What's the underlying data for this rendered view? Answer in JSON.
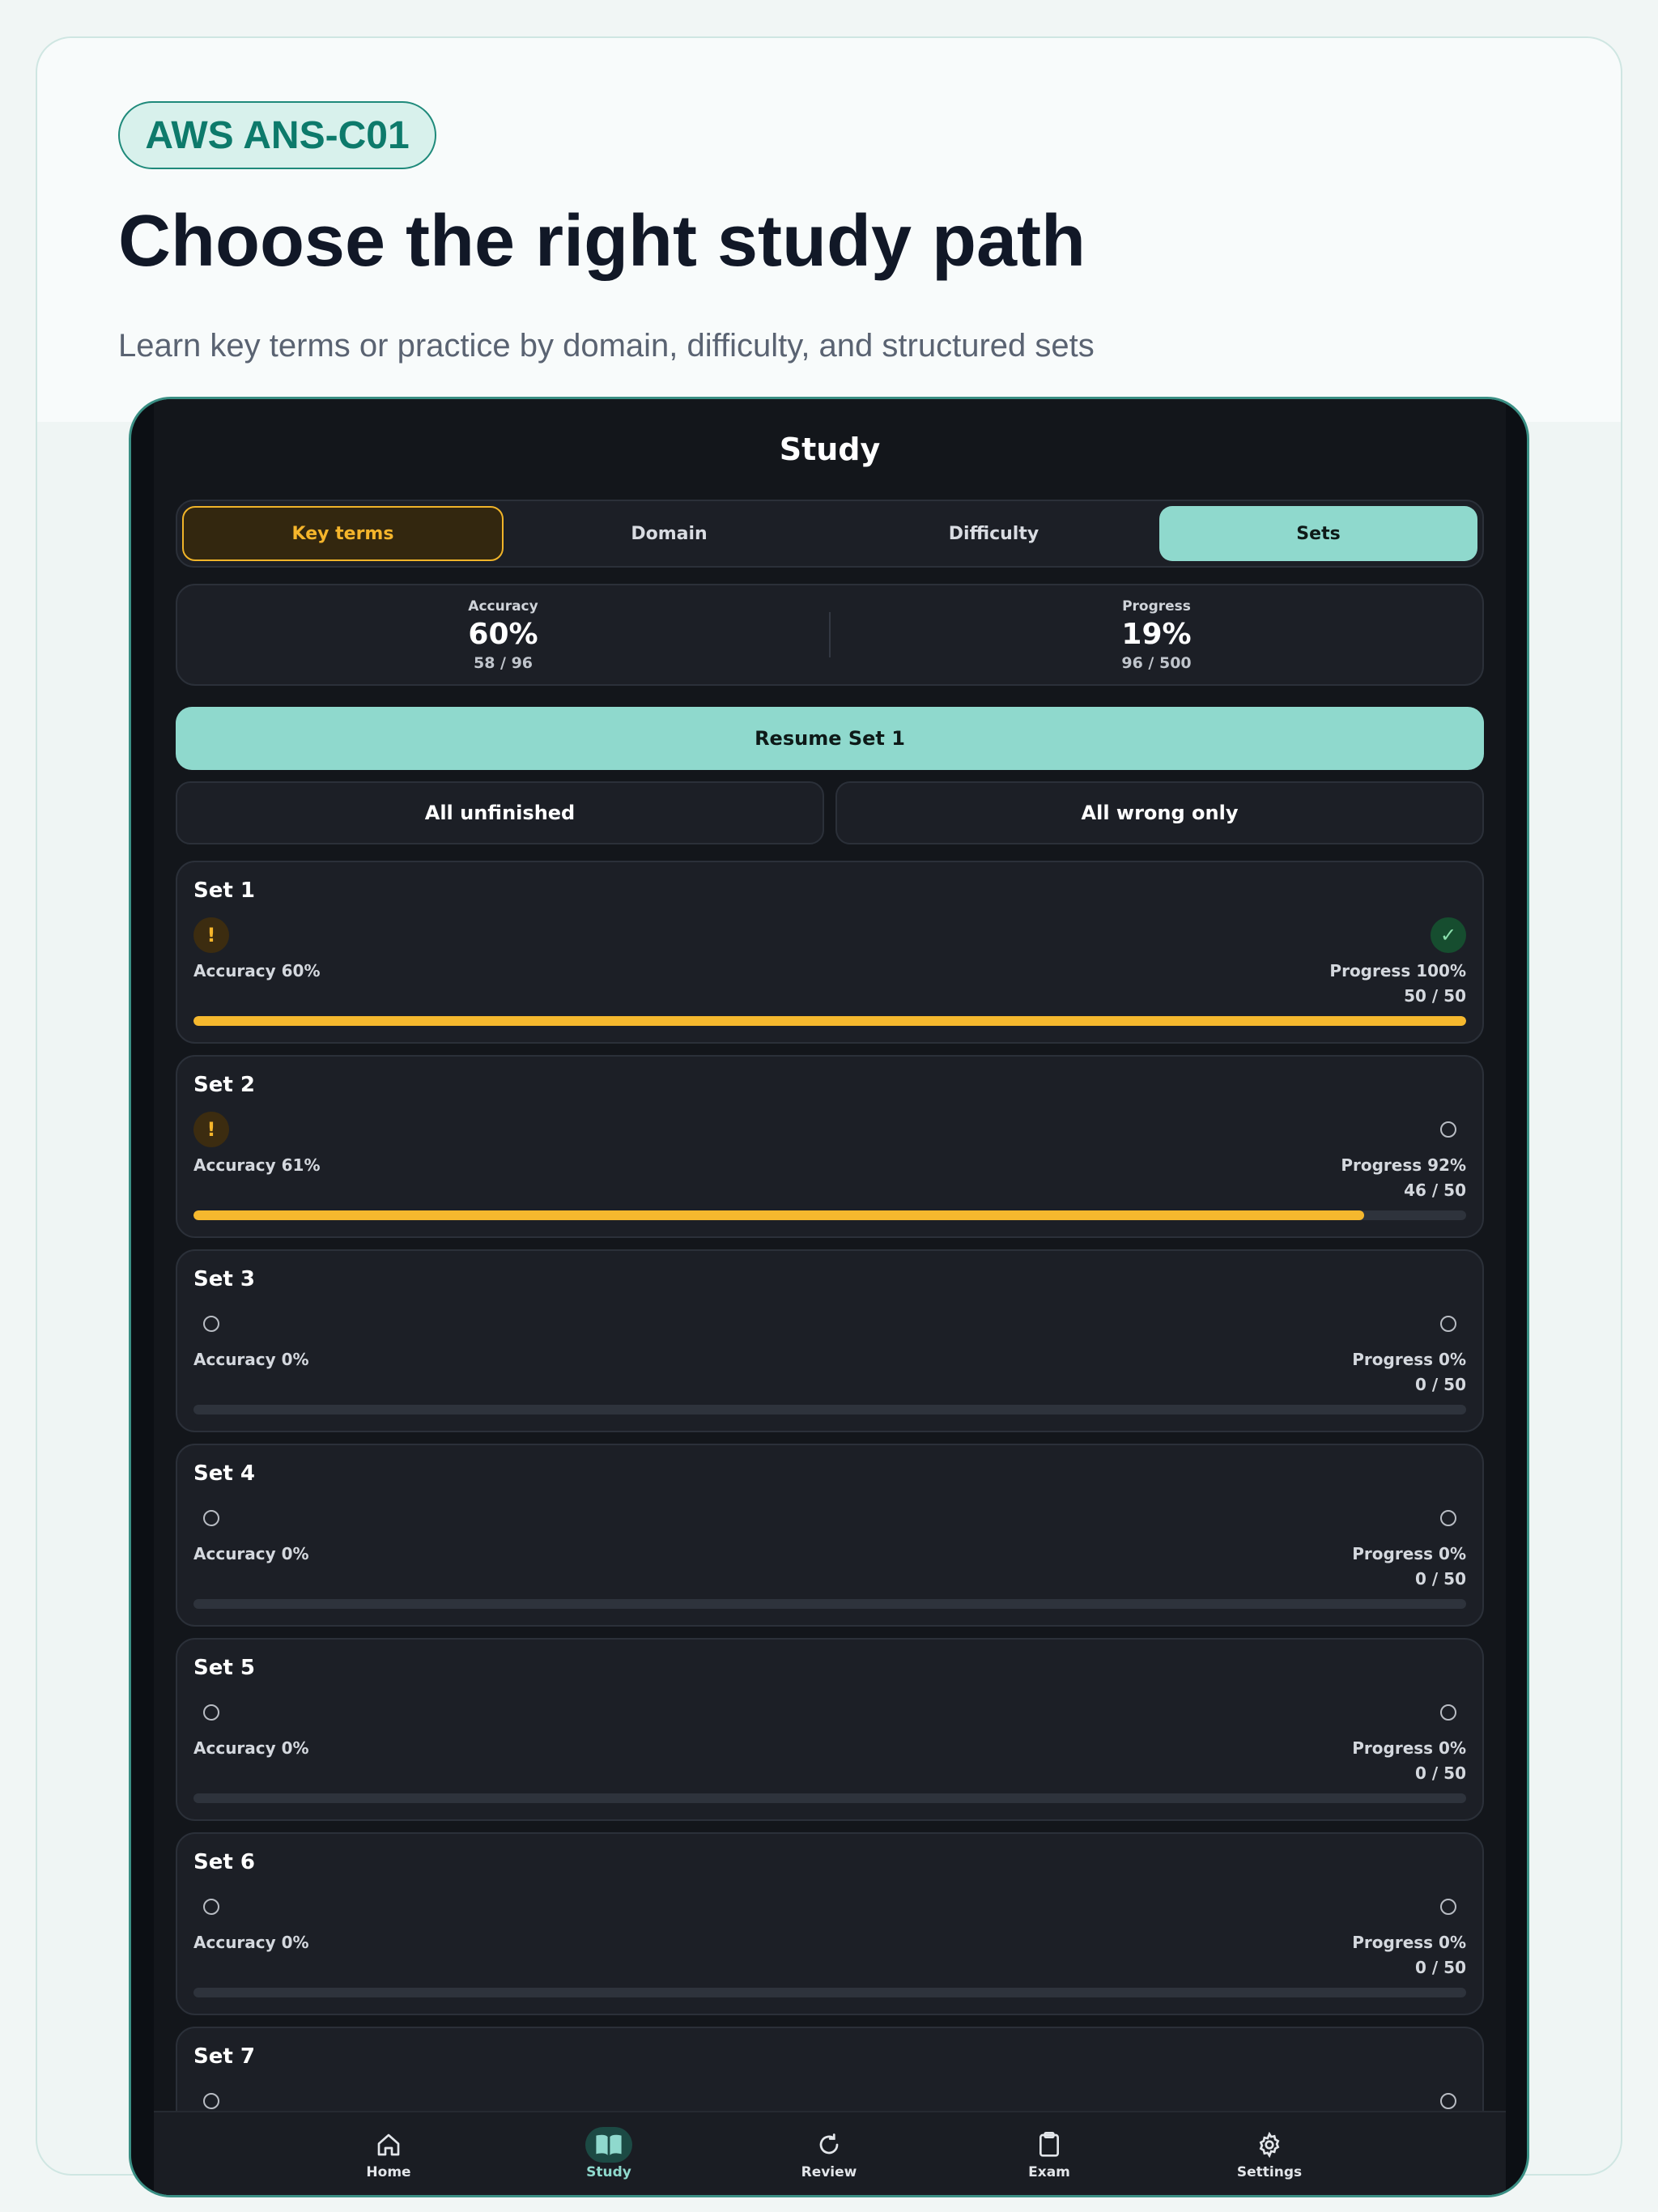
{
  "marketing": {
    "badge": "AWS ANS-C01",
    "headline": "Choose the right study path",
    "subheadline": "Learn key terms or practice by domain, difficulty, and structured sets"
  },
  "app": {
    "title": "Study"
  },
  "tabs": [
    {
      "label": "Key terms"
    },
    {
      "label": "Domain"
    },
    {
      "label": "Difficulty"
    },
    {
      "label": "Sets",
      "active": true
    }
  ],
  "stats": {
    "accuracy": {
      "label": "Accuracy",
      "value": "60%",
      "detail": "58 / 96"
    },
    "progress": {
      "label": "Progress",
      "value": "19%",
      "detail": "96 / 500"
    }
  },
  "resume_button": "Resume Set 1",
  "filters": {
    "unfinished": "All unfinished",
    "wrong": "All wrong only"
  },
  "sets": [
    {
      "name": "Set 1",
      "accuracy": "Accuracy 60%",
      "progress": "Progress 100%",
      "count": "50 / 50",
      "fraction": 1.0,
      "left_icon": "warning-icon",
      "right_icon": "check-icon"
    },
    {
      "name": "Set 2",
      "accuracy": "Accuracy 61%",
      "progress": "Progress 92%",
      "count": "46 / 50",
      "fraction": 0.92,
      "left_icon": "warning-icon",
      "right_icon": "empty-circle-icon"
    },
    {
      "name": "Set 3",
      "accuracy": "Accuracy 0%",
      "progress": "Progress 0%",
      "count": "0 / 50",
      "fraction": 0,
      "left_icon": "empty-circle-icon",
      "right_icon": "empty-circle-icon"
    },
    {
      "name": "Set 4",
      "accuracy": "Accuracy 0%",
      "progress": "Progress 0%",
      "count": "0 / 50",
      "fraction": 0,
      "left_icon": "empty-circle-icon",
      "right_icon": "empty-circle-icon"
    },
    {
      "name": "Set 5",
      "accuracy": "Accuracy 0%",
      "progress": "Progress 0%",
      "count": "0 / 50",
      "fraction": 0,
      "left_icon": "empty-circle-icon",
      "right_icon": "empty-circle-icon"
    },
    {
      "name": "Set 6",
      "accuracy": "Accuracy 0%",
      "progress": "Progress 0%",
      "count": "0 / 50",
      "fraction": 0,
      "left_icon": "empty-circle-icon",
      "right_icon": "empty-circle-icon"
    },
    {
      "name": "Set 7",
      "left_icon": "empty-circle-icon",
      "right_icon": "empty-circle-icon"
    }
  ],
  "nav": [
    {
      "label": "Home",
      "icon": "home-icon"
    },
    {
      "label": "Study",
      "icon": "book-icon",
      "active": true
    },
    {
      "label": "Review",
      "icon": "refresh-icon"
    },
    {
      "label": "Exam",
      "icon": "clipboard-icon"
    },
    {
      "label": "Settings",
      "icon": "gear-icon"
    }
  ],
  "colors": {
    "accent": "#8fd9cd",
    "warning": "#f5b52b",
    "brand": "#0d7a6b",
    "background": "#13161b"
  }
}
